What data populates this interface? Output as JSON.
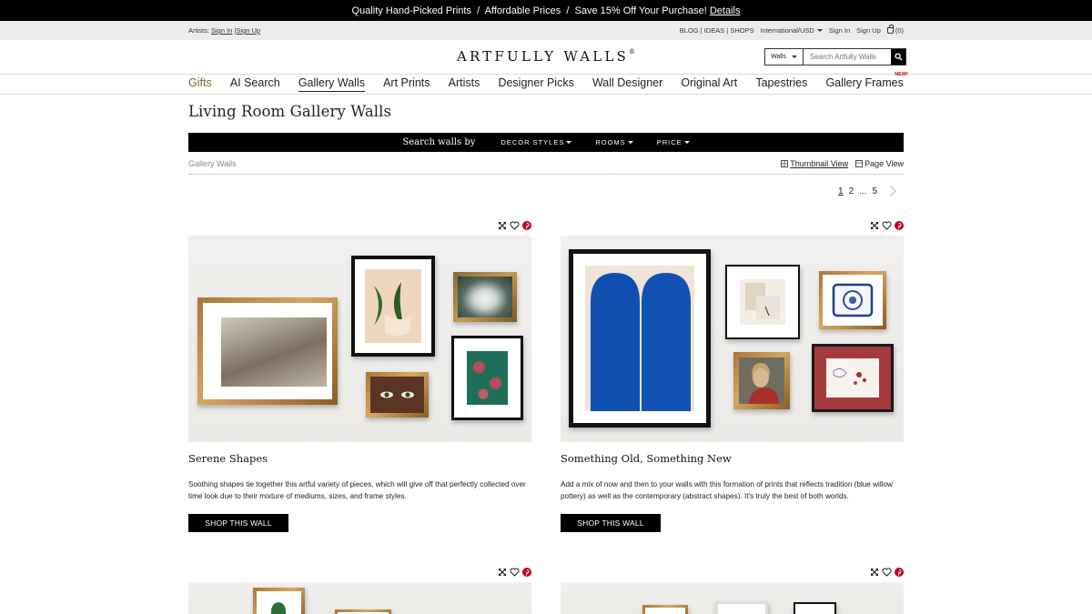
{
  "promo": {
    "text": "Quality Hand-Picked Prints  /  Affordable Prices  /  Save 15% Off Your Purchase!",
    "link": "Details"
  },
  "utility": {
    "artists_label": "Artists:",
    "sign_in": "Sign In",
    "separator": "|",
    "sign_up": "Sign Up",
    "links": "BLOG | IDEAS | SHOPS",
    "region": "International/USD",
    "right_sign_in": "Sign In",
    "right_sign_up": "Sign Up",
    "cart": "(0)"
  },
  "logo": "ARTFULLY WALLS",
  "logo_mark": "®",
  "search": {
    "scope": "Walls",
    "placeholder": "Search Artfully Walls"
  },
  "nav": {
    "items": [
      "Gifts",
      "AI Search",
      "Gallery Walls",
      "Art Prints",
      "Artists",
      "Designer Picks",
      "Wall Designer",
      "Original Art",
      "Tapestries",
      "Gallery Frames"
    ],
    "new_badge": "NEW!"
  },
  "page_title": "Living Room Gallery Walls",
  "filter": {
    "label": "Search walls by",
    "options": [
      "DECOR STYLES",
      "ROOMS",
      "PRICE"
    ]
  },
  "breadcrumb": "Gallery Walls",
  "views": {
    "thumbnail": "Thumbnail View",
    "page": "Page View"
  },
  "pagination": {
    "p1": "1",
    "p2": "2",
    "ellipsis": "...",
    "p5": "5"
  },
  "cards": [
    {
      "title": "Serene Shapes",
      "description": "Soothing shapes tie together this artful variety of pieces, which will give off that perfectly collected over time look due to their mixture of mediums, sizes, and frame styles.",
      "button": "SHOP THIS WALL"
    },
    {
      "title": "Something Old, Something New",
      "description": "Add a mix of now and then to your walls with this formation of prints that reflects tradition (blue willow pottery) as well as the contemporary (abstract shapes). It's truly the best of both worlds.",
      "button": "SHOP THIS WALL"
    }
  ],
  "colors": {
    "accent_gifts": "#7d6a2c",
    "promo_bg": "#000000",
    "pin_red": "#bd081c"
  }
}
